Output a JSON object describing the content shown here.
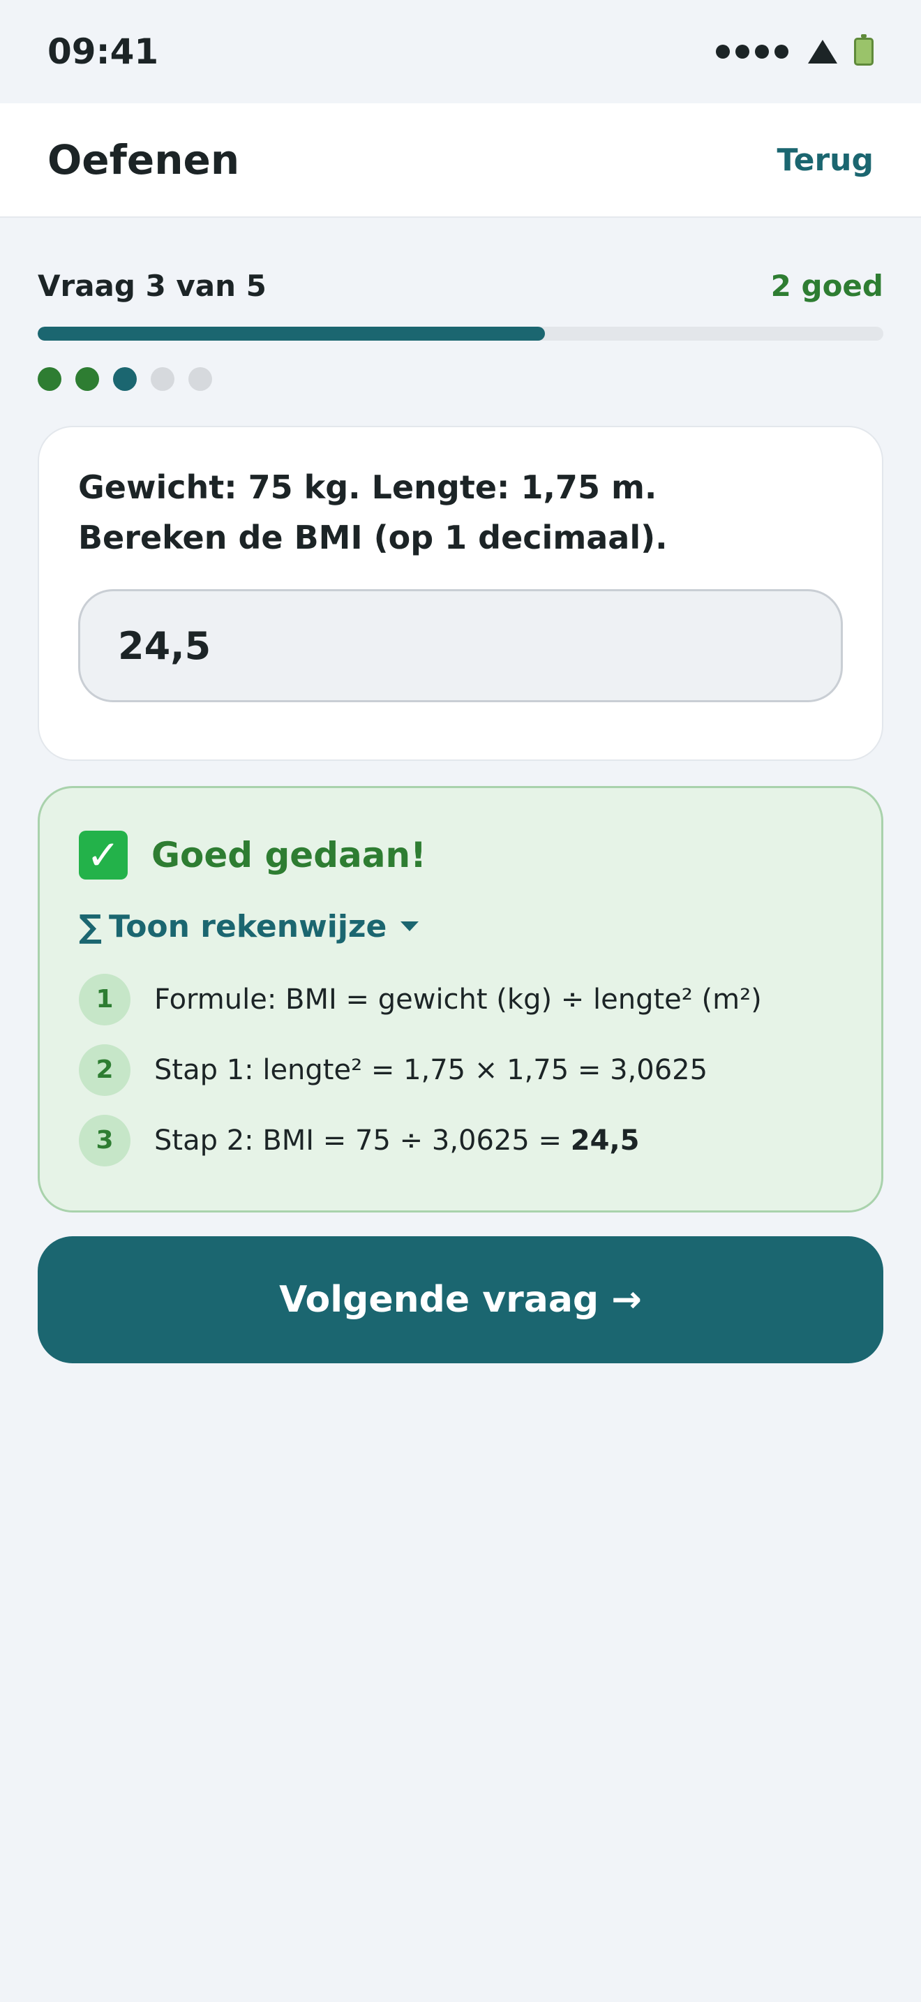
{
  "status_bar": {
    "time": "09:41",
    "signal_icon": "signal-dots-icon",
    "wifi_icon": "wifi-icon",
    "battery_icon": "battery-icon"
  },
  "header": {
    "title": "Oefenen",
    "back_label": "Terug"
  },
  "progress": {
    "label": "Vraag 3 van 5",
    "score": "2 goed",
    "fraction": 0.6,
    "dots": [
      "correct",
      "correct",
      "current",
      "pending",
      "pending"
    ]
  },
  "question": {
    "line1": "Gewicht: 75 kg. Lengte: 1,75 m.",
    "line2": "Bereken de BMI (op 1 decimaal).",
    "answer_value": "24,5"
  },
  "feedback": {
    "icon": "check-icon",
    "title": "Goed gedaan!",
    "toggle_symbol": "∑",
    "toggle_label": "Toon rekenwijze",
    "steps": [
      {
        "number": "1",
        "text": "Formule: BMI = gewicht (kg) ÷ lengte² (m²)",
        "result": ""
      },
      {
        "number": "2",
        "text": "Stap 1: lengte² = 1,75 × 1,75 = 3,0625",
        "result": ""
      },
      {
        "number": "3",
        "text": "Stap 2: BMI = 75 ÷ 3,0625 = ",
        "result": "24,5"
      }
    ]
  },
  "next_button": {
    "label": "Volgende vraag →"
  },
  "colors": {
    "accent": "#1b6670",
    "success": "#2e7d32",
    "success_bg": "#e6f3e7",
    "background": "#f1f4f8"
  }
}
